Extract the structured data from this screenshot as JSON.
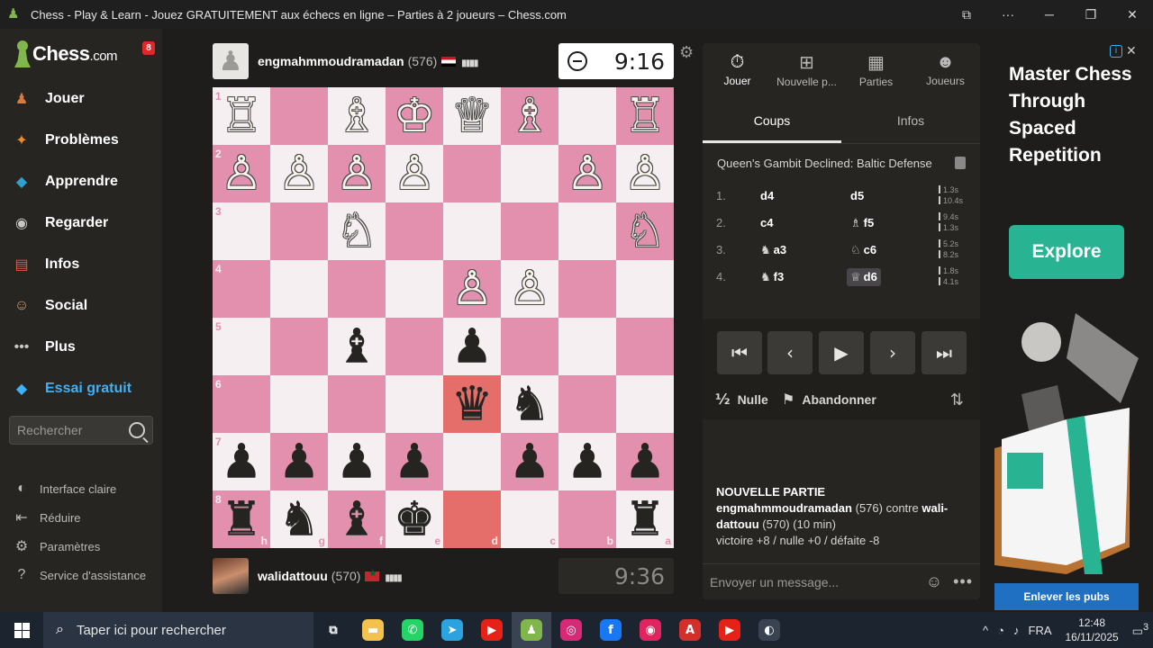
{
  "window": {
    "title": "Chess - Play & Learn - Jouez GRATUITEMENT aux échecs en ligne – Parties à 2 joueurs – Chess.com"
  },
  "sidebar": {
    "logo_main": "Chess",
    "logo_suffix": ".com",
    "notification_count": "8",
    "items": [
      {
        "label": "Jouer",
        "icon": "play-pawn-icon",
        "color": "#d67a3e"
      },
      {
        "label": "Problèmes",
        "icon": "puzzle-icon",
        "color": "#f08a24"
      },
      {
        "label": "Apprendre",
        "icon": "learn-cap-icon",
        "color": "#2f9fd0"
      },
      {
        "label": "Regarder",
        "icon": "binoculars-icon",
        "color": "#c9c7c4"
      },
      {
        "label": "Infos",
        "icon": "news-icon",
        "color": "#e05a4a"
      },
      {
        "label": "Social",
        "icon": "social-icon",
        "color": "#d9a06b"
      },
      {
        "label": "Plus",
        "icon": "more-dots-icon",
        "color": "#c9c7c4"
      },
      {
        "label": "Essai gratuit",
        "icon": "diamond-icon",
        "color": "#3fb1f6"
      }
    ],
    "search_placeholder": "Rechercher",
    "footer": [
      {
        "label": "Interface claire",
        "icon": "contrast-icon"
      },
      {
        "label": "Réduire",
        "icon": "collapse-icon"
      },
      {
        "label": "Paramètres",
        "icon": "settings-icon"
      },
      {
        "label": "Service d'assistance",
        "icon": "help-icon"
      }
    ]
  },
  "top_player": {
    "name": "engmahmmoudramadan",
    "rating": "(576)",
    "clock": "9:16"
  },
  "bottom_player": {
    "name": "walidattouu",
    "rating": "(570)",
    "clock": "9:36"
  },
  "board": {
    "ranks": [
      "1",
      "2",
      "3",
      "4",
      "5",
      "6",
      "7",
      "8"
    ],
    "files": [
      "h",
      "g",
      "f",
      "e",
      "d",
      "c",
      "b",
      "a"
    ],
    "rows": [
      [
        "♖",
        "",
        "♗",
        "♔",
        "♕",
        "♗",
        "",
        "♖"
      ],
      [
        "♙",
        "♙",
        "♙",
        "♙",
        "",
        "",
        "♙",
        "♙"
      ],
      [
        "",
        "",
        "♘",
        "",
        "",
        "",
        "",
        "♘"
      ],
      [
        "",
        "",
        "",
        "",
        "♙",
        "♙",
        "",
        ""
      ],
      [
        "",
        "",
        "♝",
        "",
        "♟",
        "",
        "",
        ""
      ],
      [
        "",
        "",
        "",
        "",
        "♛",
        "♞",
        "",
        ""
      ],
      [
        "♟",
        "♟",
        "♟",
        "♟",
        "",
        "♟",
        "♟",
        "♟"
      ],
      [
        "♜",
        "♞",
        "♝",
        "♚",
        "",
        "",
        "",
        "♜"
      ]
    ],
    "white_pieces": "♔♕♖♗♘♙",
    "highlight": [
      [
        5,
        4
      ],
      [
        7,
        4
      ]
    ]
  },
  "panel": {
    "tabs": [
      {
        "label": "Jouer",
        "icon": "stopwatch-icon"
      },
      {
        "label": "Nouvelle p...",
        "icon": "plus-icon"
      },
      {
        "label": "Parties",
        "icon": "board-icon"
      },
      {
        "label": "Joueurs",
        "icon": "players-icon"
      }
    ],
    "subtabs": [
      "Coups",
      "Infos"
    ],
    "opening": "Queen's Gambit Declined: Baltic Defense",
    "moves": [
      {
        "num": "1.",
        "w_glyph": "",
        "w": "d4",
        "b_glyph": "",
        "b": "d5",
        "t1": "1.3s",
        "t2": "10.4s"
      },
      {
        "num": "2.",
        "w_glyph": "",
        "w": "c4",
        "b_glyph": "♗",
        "b": "f5",
        "t1": "9.4s",
        "t2": "1.3s"
      },
      {
        "num": "3.",
        "w_glyph": "♞",
        "w": "a3",
        "b_glyph": "♘",
        "b": "c6",
        "t1": "5.2s",
        "t2": "8.2s"
      },
      {
        "num": "4.",
        "w_glyph": "♞",
        "w": "f3",
        "b_glyph": "♕",
        "b": "d6",
        "t1": "1.8s",
        "t2": "4.1s"
      }
    ],
    "actions": {
      "draw": "Nulle",
      "draw_glyph": "½",
      "resign": "Abandonner"
    },
    "game_info": {
      "heading": "NOUVELLE PARTIE",
      "white": "engmahmmoudramadan",
      "white_rating": "(576)",
      "vs": "contre",
      "black": "wali-dattouu",
      "black_rating": "(570)",
      "time": "(10 min)",
      "result_line": "victoire +8 / nulle +0 / défaite -8"
    },
    "message_placeholder": "Envoyer un message..."
  },
  "ad": {
    "headline": "Master Chess Through Spaced Repetition",
    "cta": "Explore",
    "remove": "Enlever les pubs"
  },
  "taskbar": {
    "search_placeholder": "Taper ici pour rechercher",
    "apps": [
      {
        "icon": "task-view-icon",
        "color": "#1c2430",
        "glyph": "⧉"
      },
      {
        "icon": "file-explorer-icon",
        "color": "#f2c14e",
        "glyph": "▬"
      },
      {
        "icon": "whatsapp-icon",
        "color": "#25d366",
        "glyph": "✆"
      },
      {
        "icon": "telegram-icon",
        "color": "#2aa3de",
        "glyph": "➤"
      },
      {
        "icon": "youtube-icon",
        "color": "#e62117",
        "glyph": "▶"
      },
      {
        "icon": "chess-app-icon",
        "color": "#81b64c",
        "glyph": "♟"
      },
      {
        "icon": "instagram-icon",
        "color": "#d62976",
        "glyph": "◎"
      },
      {
        "icon": "facebook-icon",
        "color": "#1877f2",
        "glyph": "f"
      },
      {
        "icon": "screen-recorder-icon",
        "color": "#e0245e",
        "glyph": "◉"
      },
      {
        "icon": "acrobat-icon",
        "color": "#d4302b",
        "glyph": "A"
      },
      {
        "icon": "youtube-icon",
        "color": "#e62117",
        "glyph": "▶"
      },
      {
        "icon": "browser-icon",
        "color": "#3a4352",
        "glyph": "◐"
      }
    ],
    "language": "FRA",
    "time": "12:48",
    "date": "16/11/2025",
    "notification_count": "3"
  }
}
